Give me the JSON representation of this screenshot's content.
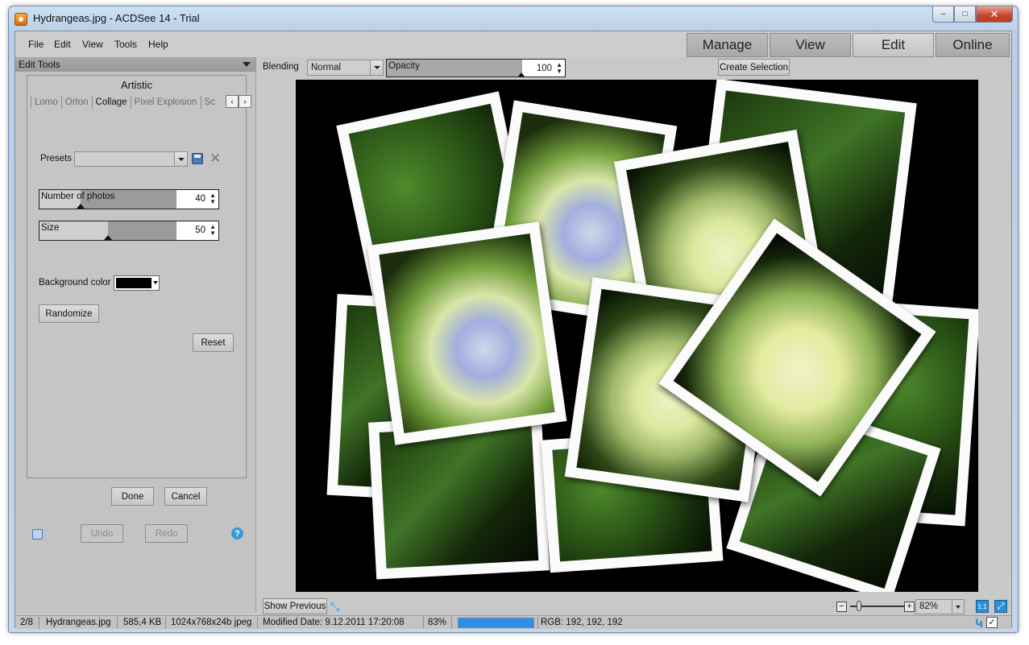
{
  "window": {
    "title": "Hydrangeas.jpg - ACDSee 14 - Trial",
    "controls": {
      "minimize": "–",
      "maximize": "□",
      "close": "✕"
    }
  },
  "menu": {
    "file": "File",
    "edit": "Edit",
    "view": "View",
    "tools": "Tools",
    "help": "Help"
  },
  "modes": {
    "manage": "Manage",
    "view": "View",
    "edit": "Edit",
    "online": "Online",
    "active": "Edit"
  },
  "panel": {
    "header": "Edit Tools",
    "tool_title": "Artistic",
    "subtabs": [
      "Lomo",
      "Orton",
      "Collage",
      "Pixel Explosion",
      "Sc"
    ],
    "active_subtab": "Collage",
    "presets_label": "Presets",
    "presets_value": "",
    "number_of_photos": {
      "label": "Number of photos",
      "value": "40",
      "fraction": 0.3
    },
    "size": {
      "label": "Size",
      "value": "50",
      "fraction": 0.5
    },
    "background_color_label": "Background color",
    "background_color": "#000000",
    "randomize": "Randomize",
    "reset": "Reset",
    "done": "Done",
    "cancel": "Cancel",
    "undo": "Undo",
    "redo": "Redo",
    "help": "?"
  },
  "image_toolbar": {
    "blending_label": "Blending",
    "blending_value": "Normal",
    "opacity_label": "Opacity",
    "opacity_value": "100",
    "create_selection": "Create Selection"
  },
  "canvas_bottom": {
    "show_previous": "Show Previous",
    "zoom_value": "82%",
    "one_to_one": "1:1"
  },
  "status": {
    "index": "2/8",
    "filename": "Hydrangeas.jpg",
    "filesize": "585,4 KB",
    "dimensions": "1024x768x24b jpeg",
    "modified": "Modified Date: 9.12.2011 17:20:08",
    "zoom": "83%",
    "progress_fraction": 1.0,
    "rgb": "RGB: 192, 192, 192"
  },
  "icons": {
    "app": "acdsee-icon",
    "save": "save-preset-icon",
    "delete": "delete-preset-icon",
    "fit": "fit-screen-icon",
    "zoom_out": "zoom-out-icon",
    "zoom_in": "zoom-in-icon"
  }
}
